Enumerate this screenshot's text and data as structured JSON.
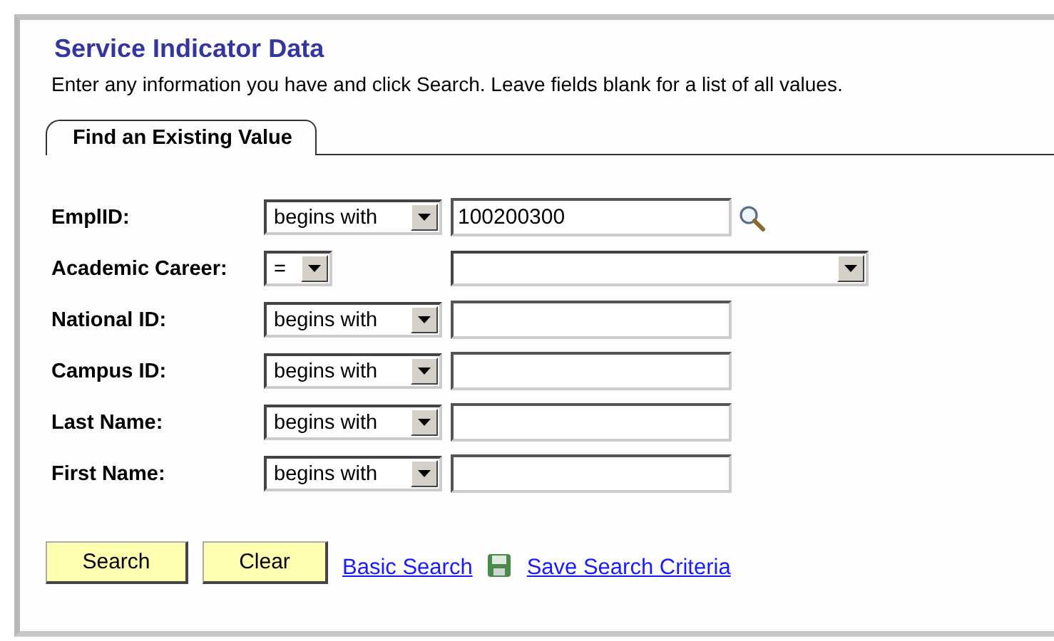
{
  "page": {
    "title": "Service Indicator Data",
    "instructions": "Enter any information you have and click Search. Leave fields blank for a list of all values."
  },
  "tabs": [
    {
      "label": "Find an Existing Value",
      "selected": true
    }
  ],
  "fields": [
    {
      "label": "EmplID:",
      "operator": "begins with",
      "kind": "text",
      "value": "100200300",
      "lookup": true
    },
    {
      "label": "Academic Career:",
      "operator": "=",
      "kind": "dropdown",
      "lookup": false
    },
    {
      "label": "National ID:",
      "operator": "begins with",
      "kind": "text",
      "lookup": false
    },
    {
      "label": "Campus ID:",
      "operator": "begins with",
      "kind": "text",
      "lookup": false
    },
    {
      "label": "Last Name:",
      "operator": "begins with",
      "kind": "text",
      "lookup": false
    },
    {
      "label": "First Name:",
      "operator": "begins with",
      "kind": "text",
      "lookup": false
    }
  ],
  "buttons": [
    "Search",
    "Clear"
  ],
  "links": [
    {
      "label": "Basic Search",
      "icon": false
    },
    {
      "label": "Save Search Criteria",
      "icon": true
    }
  ]
}
